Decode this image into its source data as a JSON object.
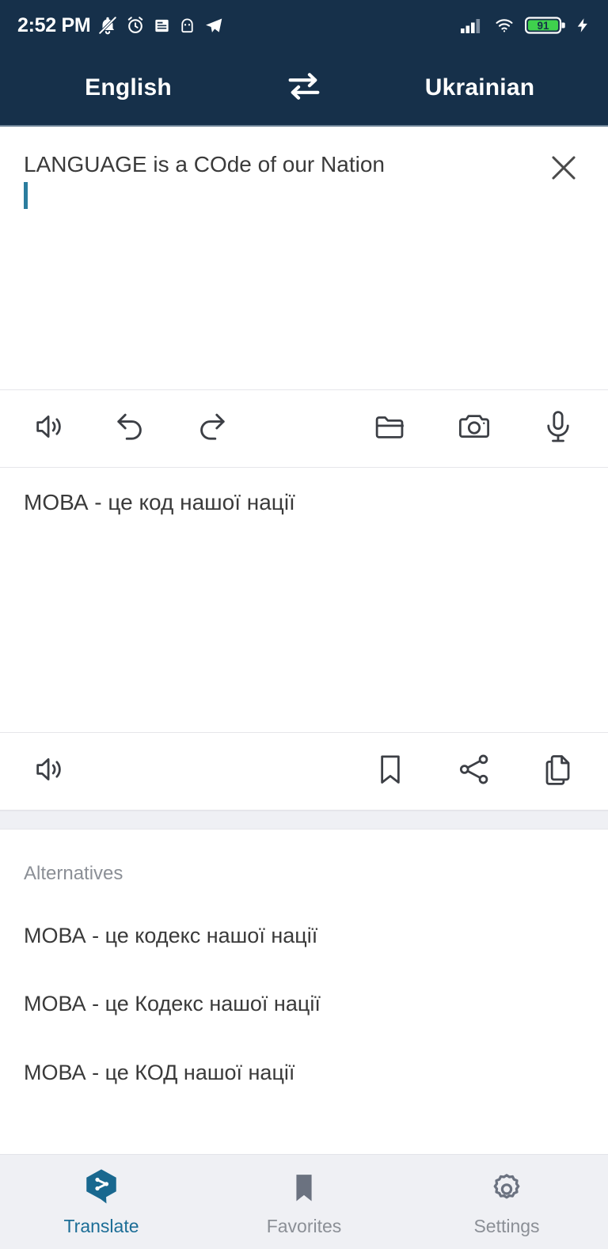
{
  "status_bar": {
    "time": "2:52 PM",
    "icons_left": [
      "bell-muted-icon",
      "alarm-clock-icon",
      "news-icon",
      "android-robot-icon",
      "telegram-send-icon"
    ],
    "icons_right": [
      "signal-bars-icon",
      "wifi-icon",
      "battery-icon",
      "charging-bolt-icon"
    ],
    "battery_level": "91"
  },
  "header": {
    "source_language": "English",
    "target_language": "Ukrainian",
    "swap_icon": "swap-horizontal-icon",
    "background_color": "#16304a"
  },
  "source_panel": {
    "text": "LANGUAGE is a COde of our Nation",
    "caret_color": "#2b7d9e",
    "clear_icon": "close-icon",
    "toolbar": {
      "speak": "speaker-icon",
      "undo": "undo-icon",
      "redo": "redo-icon",
      "folder": "folder-icon",
      "camera": "camera-icon",
      "microphone": "microphone-icon"
    }
  },
  "target_panel": {
    "text": "МОВА - це код нашої нації",
    "toolbar": {
      "speak": "speaker-icon",
      "bookmark": "bookmark-icon",
      "share": "share-icon",
      "copy": "copy-icon"
    }
  },
  "alternatives": {
    "title": "Alternatives",
    "items": [
      "МОВА - це кодекс нашої нації",
      "МОВА - це Кодекс нашої нації",
      "МОВА - це КОД нашої нації"
    ]
  },
  "bottom_nav": {
    "active_color": "#1b6d96",
    "inactive_color": "#8b8f96",
    "items": [
      {
        "label": "Translate",
        "icon": "translate-logo-icon",
        "active": true
      },
      {
        "label": "Favorites",
        "icon": "bookmark-icon",
        "active": false
      },
      {
        "label": "Settings",
        "icon": "gear-icon",
        "active": false
      }
    ]
  }
}
